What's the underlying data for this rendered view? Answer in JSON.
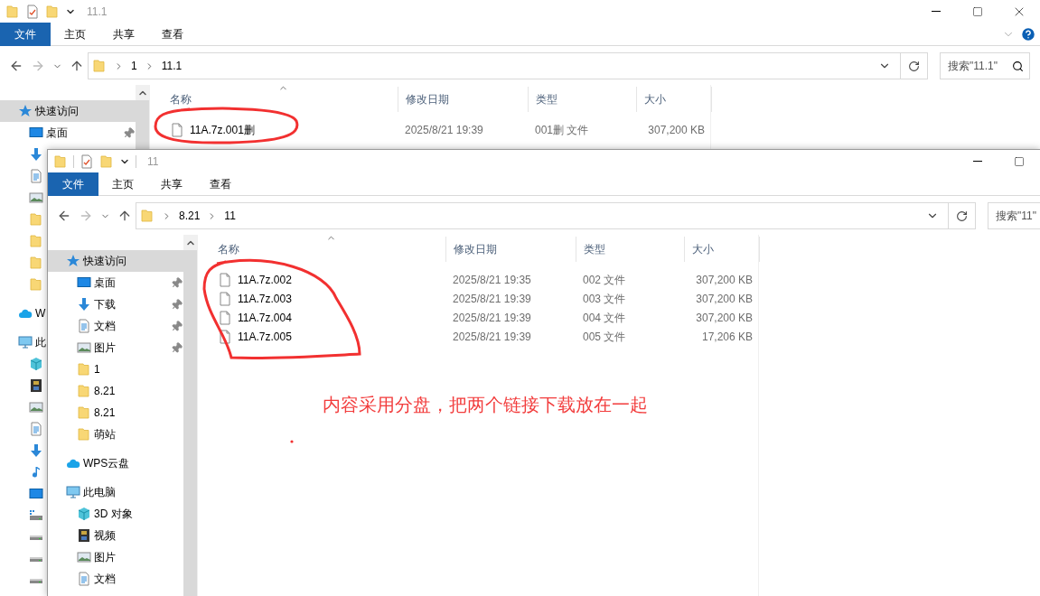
{
  "windows": [
    {
      "title": "11.1",
      "ribbon_tabs": [
        {
          "label": "文件",
          "selected": true
        },
        {
          "label": "主页",
          "selected": false
        },
        {
          "label": "共享",
          "selected": false
        },
        {
          "label": "查看",
          "selected": false
        }
      ],
      "path": [
        "1",
        "11.1"
      ],
      "search": {
        "placeholder": "搜索\"11.1\""
      },
      "sidebar": [
        {
          "kind": "star",
          "label": "快速访问",
          "selected": true,
          "children": [
            {
              "kind": "desktop",
              "label": "桌面",
              "pinned": true
            },
            {
              "kind": "download"
            },
            {
              "kind": "document"
            },
            {
              "kind": "picture"
            },
            {
              "kind": "folder"
            },
            {
              "kind": "folder"
            },
            {
              "kind": "folder"
            },
            {
              "kind": "folder"
            }
          ]
        },
        {
          "kind": "cloud",
          "label": "W",
          "selected": false
        },
        {
          "kind": "pc",
          "label": "此",
          "selected": false,
          "children": [
            {
              "kind": "cube"
            },
            {
              "kind": "video"
            },
            {
              "kind": "picture"
            },
            {
              "kind": "document"
            },
            {
              "kind": "download"
            },
            {
              "kind": "music"
            },
            {
              "kind": "desktop"
            },
            {
              "kind": "drive_win"
            },
            {
              "kind": "drive"
            },
            {
              "kind": "drive"
            },
            {
              "kind": "drive"
            }
          ]
        }
      ],
      "columns": [
        "名称",
        "修改日期",
        "类型",
        "大小"
      ],
      "files": [
        {
          "name": "11A.7z.001删",
          "date": "2025/8/21 19:39",
          "type": "001删 文件",
          "size": "307,200 KB"
        }
      ]
    },
    {
      "title": "11",
      "ribbon_tabs": [
        {
          "label": "文件",
          "selected": true
        },
        {
          "label": "主页",
          "selected": false
        },
        {
          "label": "共享",
          "selected": false
        },
        {
          "label": "查看",
          "selected": false
        }
      ],
      "path": [
        "8.21",
        "11"
      ],
      "search": {
        "placeholder": "搜索\"11\""
      },
      "sidebar": [
        {
          "kind": "star",
          "label": "快速访问",
          "selected": true,
          "children": [
            {
              "kind": "desktop",
              "label": "桌面",
              "pinned": true
            },
            {
              "kind": "download",
              "label": "下载",
              "pinned": true
            },
            {
              "kind": "document",
              "label": "文档",
              "pinned": true
            },
            {
              "kind": "picture",
              "label": "图片",
              "pinned": true
            },
            {
              "kind": "folder",
              "label": "1",
              "pinned": false
            },
            {
              "kind": "folder",
              "label": "8.21",
              "pinned": false
            },
            {
              "kind": "folder",
              "label": "8.21",
              "pinned": false
            },
            {
              "kind": "folder",
              "label": "萌站",
              "pinned": false
            }
          ]
        },
        {
          "kind": "cloud",
          "label": "WPS云盘",
          "selected": false
        },
        {
          "kind": "pc",
          "label": "此电脑",
          "selected": false,
          "children": [
            {
              "kind": "cube",
              "label": "3D 对象"
            },
            {
              "kind": "video",
              "label": "视频"
            },
            {
              "kind": "picture",
              "label": "图片"
            },
            {
              "kind": "document",
              "label": "文档"
            }
          ]
        }
      ],
      "columns": [
        "名称",
        "修改日期",
        "类型",
        "大小"
      ],
      "files": [
        {
          "name": "11A.7z.002",
          "date": "2025/8/21 19:35",
          "type": "002 文件",
          "size": "307,200 KB"
        },
        {
          "name": "11A.7z.003",
          "date": "2025/8/21 19:39",
          "type": "003 文件",
          "size": "307,200 KB"
        },
        {
          "name": "11A.7z.004",
          "date": "2025/8/21 19:39",
          "type": "004 文件",
          "size": "307,200 KB"
        },
        {
          "name": "11A.7z.005",
          "date": "2025/8/21 19:39",
          "type": "005 文件",
          "size": "17,206 KB"
        }
      ]
    }
  ],
  "annotation": {
    "text": "内容采用分盘，把两个链接下载放在一起"
  }
}
